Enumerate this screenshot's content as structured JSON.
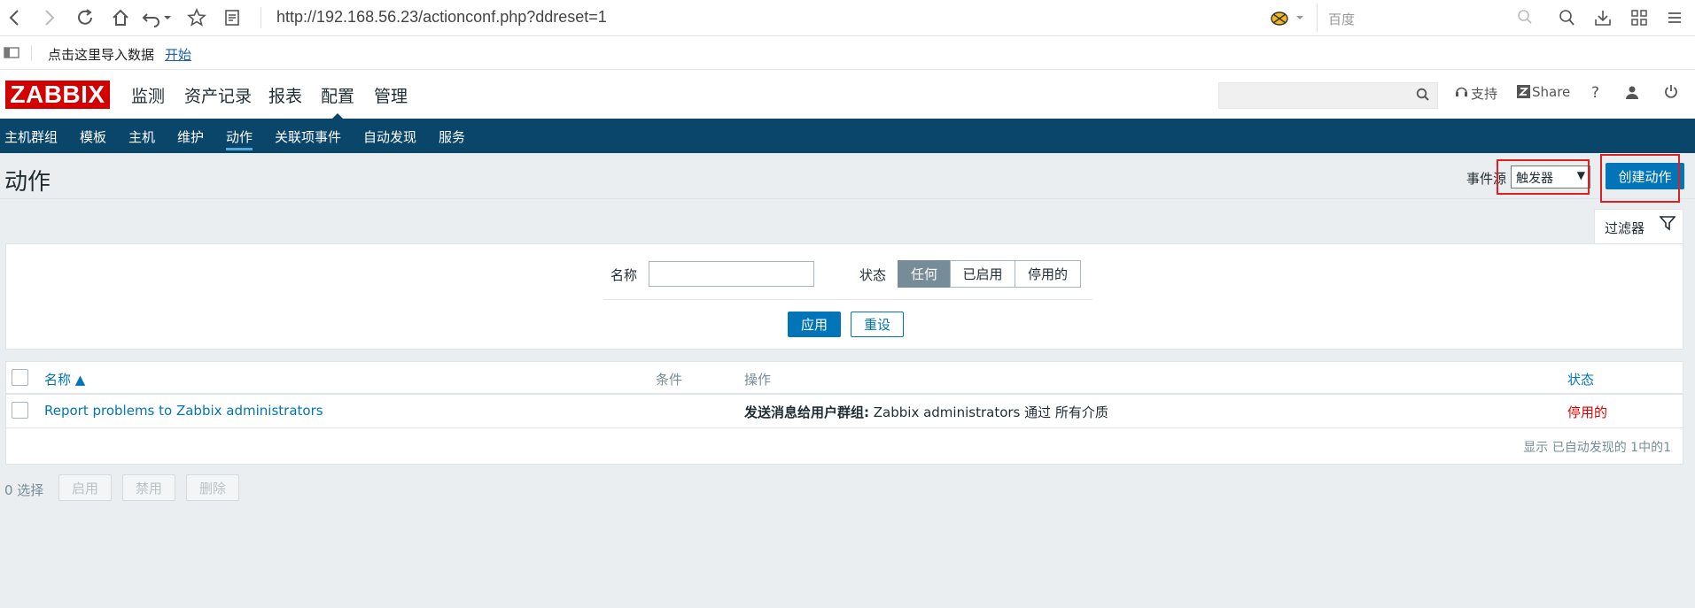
{
  "browser": {
    "url": "http://192.168.56.23/actionconf.php?ddreset=1",
    "search_placeholder": "百度"
  },
  "bookmarks": {
    "import_text": "点击这里导入数据",
    "start_link": "开始"
  },
  "header": {
    "logo": "ZABBIX",
    "menu": [
      "监测",
      "资产记录",
      "报表",
      "配置",
      "管理"
    ],
    "selected_menu": "配置",
    "support_label": "支持",
    "share_label": "Share",
    "help_label": "?"
  },
  "subnav": {
    "items": [
      "主机群组",
      "模板",
      "主机",
      "维护",
      "动作",
      "关联项事件",
      "自动发现",
      "服务"
    ],
    "selected": "动作"
  },
  "page": {
    "title": "动作",
    "event_source_label": "事件源",
    "event_source_value": "触发器",
    "create_button": "创建动作"
  },
  "filter": {
    "tab_label": "过滤器",
    "name_label": "名称",
    "name_value": "",
    "status_label": "状态",
    "status_options": [
      "任何",
      "已启用",
      "停用的"
    ],
    "status_selected": "任何",
    "apply_button": "应用",
    "reset_button": "重设"
  },
  "table": {
    "columns": [
      "名称 ▲",
      "条件",
      "操作",
      "状态"
    ],
    "rows": [
      {
        "name": "Report problems to Zabbix administrators",
        "conditions": "",
        "operation_bold": "发送消息给用户群组:",
        "operation_rest": " Zabbix administrators 通过 所有介质",
        "status": "停用的"
      }
    ],
    "footer": "显示 已自动发现的 1中的1"
  },
  "actions": {
    "selected_count": "0 选择",
    "enable_button": "启用",
    "disable_button": "禁用",
    "delete_button": "删除"
  },
  "colors": {
    "brand_red": "#d40000",
    "nav_blue": "#0a466a",
    "primary_blue": "#0275b8",
    "disabled_red": "#dc0000"
  }
}
